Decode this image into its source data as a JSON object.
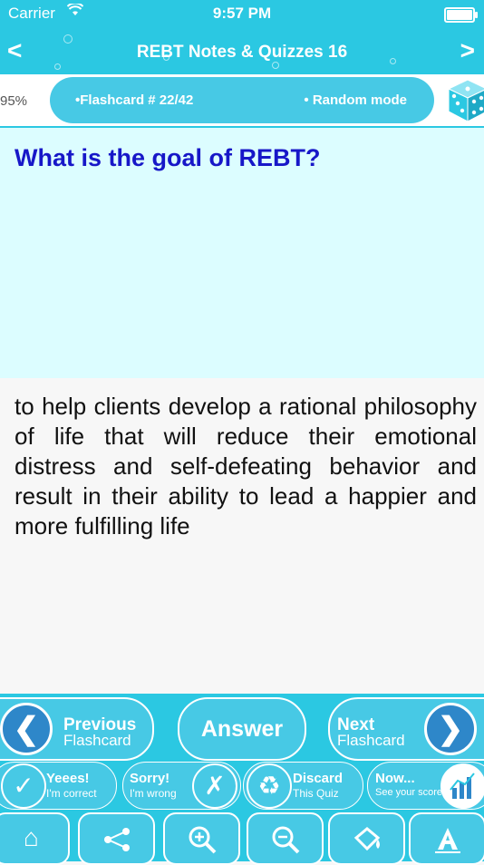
{
  "status": {
    "carrier": "Carrier",
    "time": "9:57 PM"
  },
  "nav": {
    "title": "REBT Notes & Quizzes 16",
    "back": "<",
    "forward": ">"
  },
  "progress": {
    "percent_text": "95%",
    "flashcard": "•Flashcard #  22/42",
    "mode": "• Random mode"
  },
  "card": {
    "question": "What is the goal of REBT?",
    "answer": "to help clients develop a rational philosophy of life that will reduce their emotional distress and self-defeating behavior and result in their ability to lead a happier and more fulfilling life"
  },
  "main_buttons": {
    "prev_line1": "Previous",
    "prev_line2": "Flashcard",
    "answer": "Answer",
    "next_line1": "Next",
    "next_line2": "Flashcard"
  },
  "score_buttons": {
    "yes_line1": "Yeees!",
    "yes_line2": "I'm correct",
    "sorry_line1": "Sorry!",
    "sorry_line2": "I'm wrong",
    "discard_line1": "Discard",
    "discard_line2": "This Quiz",
    "now_line1": "Now...",
    "now_line2": "See your score"
  },
  "toolbar": [
    "home-icon",
    "share-icon",
    "zoom-in-icon",
    "zoom-out-icon",
    "paint-icon",
    "font-icon"
  ],
  "colors": {
    "accent": "#2bc8e2",
    "button": "#47c9e5",
    "question_bg": "#dcfdff",
    "question_text": "#1717c8",
    "circle_blue": "#2e87c9"
  }
}
